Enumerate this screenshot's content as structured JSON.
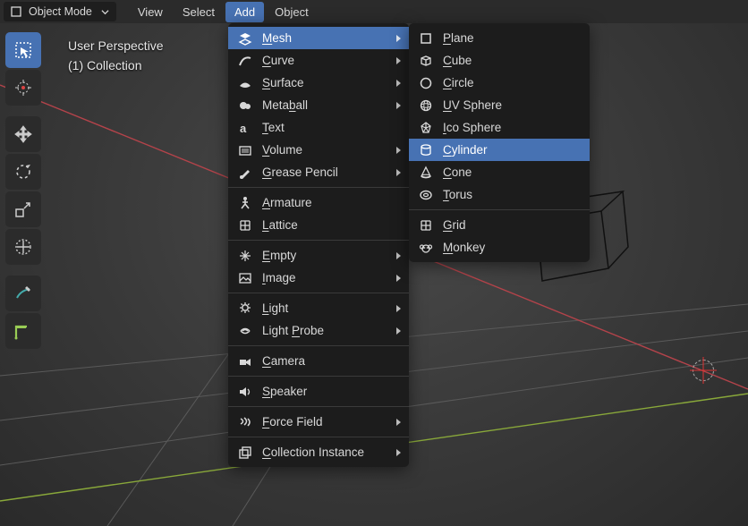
{
  "header": {
    "mode_label": "Object Mode",
    "menus": {
      "view": "View",
      "select": "Select",
      "add": "Add",
      "object": "Object"
    }
  },
  "overlay": {
    "line1": "User Perspective",
    "line2": "(1) Collection"
  },
  "toolbar": {
    "items": [
      {
        "name": "select-box-tool",
        "active": true
      },
      {
        "name": "cursor-tool"
      },
      {
        "name": "move-tool"
      },
      {
        "name": "rotate-tool"
      },
      {
        "name": "scale-tool"
      },
      {
        "name": "transform-tool"
      },
      {
        "name": "annotate-tool"
      },
      {
        "name": "measure-tool"
      }
    ]
  },
  "add_menu": {
    "items": [
      {
        "label": "Mesh",
        "accel": "M",
        "icon": "mesh-icon",
        "submenu": true,
        "highlight": true
      },
      {
        "label": "Curve",
        "accel": "C",
        "icon": "curve-icon",
        "submenu": true
      },
      {
        "label": "Surface",
        "accel": "S",
        "icon": "surface-icon",
        "submenu": true
      },
      {
        "label": "Metaball",
        "accel": "b",
        "icon": "metaball-icon",
        "submenu": true
      },
      {
        "label": "Text",
        "accel": "T",
        "icon": "text-icon"
      },
      {
        "label": "Volume",
        "accel": "V",
        "icon": "volume-icon",
        "submenu": true
      },
      {
        "label": "Grease Pencil",
        "accel": "G",
        "icon": "grease-pencil-icon",
        "submenu": true
      },
      {
        "sep": true
      },
      {
        "label": "Armature",
        "accel": "A",
        "icon": "armature-icon"
      },
      {
        "label": "Lattice",
        "accel": "L",
        "icon": "lattice-icon"
      },
      {
        "sep": true
      },
      {
        "label": "Empty",
        "accel": "E",
        "icon": "empty-icon",
        "submenu": true
      },
      {
        "label": "Image",
        "accel": "I",
        "icon": "image-icon",
        "submenu": true
      },
      {
        "sep": true
      },
      {
        "label": "Light",
        "accel": "L",
        "icon": "light-icon",
        "submenu": true
      },
      {
        "label": "Light Probe",
        "accel": "P",
        "icon": "light-probe-icon",
        "submenu": true
      },
      {
        "sep": true
      },
      {
        "label": "Camera",
        "accel": "C",
        "icon": "camera-icon"
      },
      {
        "sep": true
      },
      {
        "label": "Speaker",
        "accel": "S",
        "icon": "speaker-icon"
      },
      {
        "sep": true
      },
      {
        "label": "Force Field",
        "accel": "F",
        "icon": "force-field-icon",
        "submenu": true
      },
      {
        "sep": true
      },
      {
        "label": "Collection Instance",
        "accel": "C",
        "icon": "collection-instance-icon",
        "submenu": true
      }
    ]
  },
  "mesh_submenu": {
    "items": [
      {
        "label": "Plane",
        "accel": "P",
        "icon": "plane-icon"
      },
      {
        "label": "Cube",
        "accel": "C",
        "icon": "cube-icon"
      },
      {
        "label": "Circle",
        "accel": "C",
        "icon": "circle-icon"
      },
      {
        "label": "UV Sphere",
        "accel": "U",
        "icon": "uv-sphere-icon"
      },
      {
        "label": "Ico Sphere",
        "accel": "I",
        "icon": "ico-sphere-icon"
      },
      {
        "label": "Cylinder",
        "accel": "C",
        "icon": "cylinder-icon",
        "highlight": true
      },
      {
        "label": "Cone",
        "accel": "C",
        "icon": "cone-icon"
      },
      {
        "label": "Torus",
        "accel": "T",
        "icon": "torus-icon"
      },
      {
        "sep": true
      },
      {
        "label": "Grid",
        "accel": "G",
        "icon": "grid-icon"
      },
      {
        "label": "Monkey",
        "accel": "M",
        "icon": "monkey-icon"
      }
    ]
  }
}
